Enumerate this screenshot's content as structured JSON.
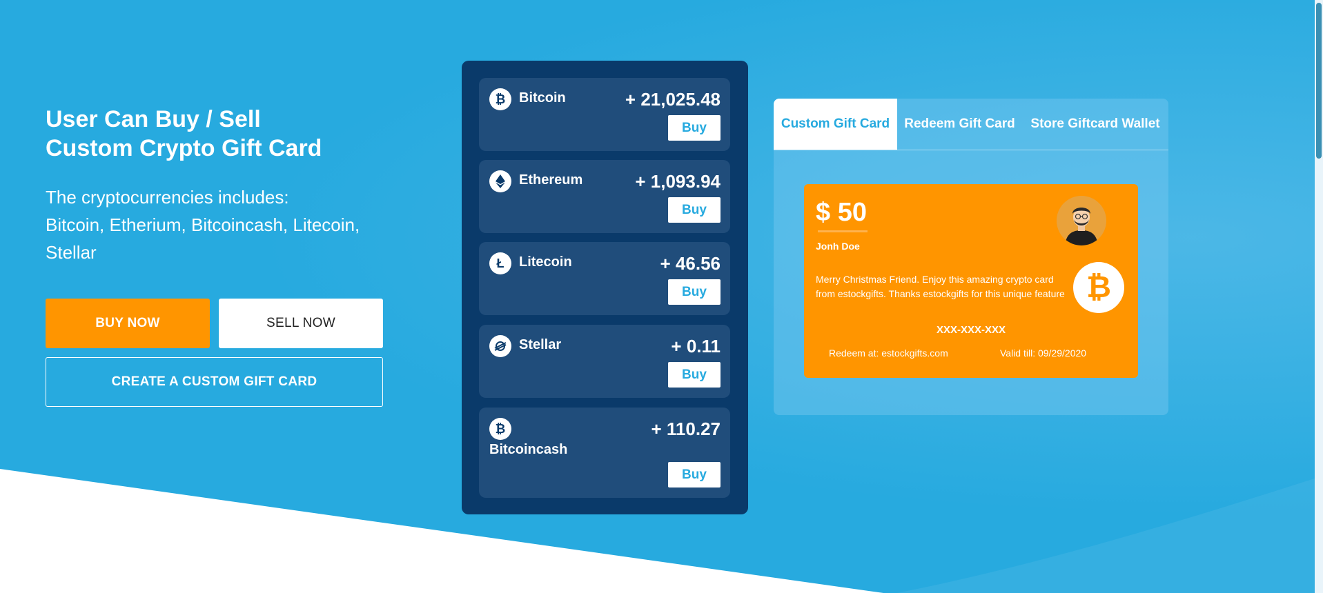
{
  "hero": {
    "title": "User Can Buy / Sell\nCustom Crypto Gift Card",
    "subtitle": "The cryptocurrencies includes:\nBitcoin, Etherium, Bitcoincash, Litecoin,\nStellar",
    "buy_now_label": "BUY NOW",
    "sell_now_label": "SELL NOW",
    "custom_card_label": "CREATE A CUSTOM GIFT CARD"
  },
  "coins": [
    {
      "name": "Bitcoin",
      "value": "+ 21,025.48",
      "buy_label": "Buy",
      "icon": "bitcoin-icon"
    },
    {
      "name": "Ethereum",
      "value": "+ 1,093.94",
      "buy_label": "Buy",
      "icon": "ethereum-icon"
    },
    {
      "name": "Litecoin",
      "value": "+ 46.56",
      "buy_label": "Buy",
      "icon": "litecoin-icon"
    },
    {
      "name": "Stellar",
      "value": "+ 0.11",
      "buy_label": "Buy",
      "icon": "stellar-icon"
    },
    {
      "name": "Bitcoincash",
      "value": "+ 110.27",
      "buy_label": "Buy",
      "icon": "bitcoincash-icon"
    }
  ],
  "tabs": [
    {
      "label": "Custom Gift Card",
      "active": true
    },
    {
      "label": "Redeem Gift Card",
      "active": false
    },
    {
      "label": "Store Giftcard Wallet",
      "active": false
    }
  ],
  "giftcard": {
    "amount": "$ 50",
    "holder": "Jonh Doe",
    "message": "Merry Christmas Friend. Enjoy this amazing crypto card from estockgifts. Thanks estockgifts for this unique feature",
    "code": "XXX-XXX-XXX",
    "redeem": "Redeem at: estockgifts.com",
    "valid": "Valid till: 09/29/2020",
    "btc_symbol": "₿"
  },
  "colors": {
    "background": "#27aadf",
    "accent_orange": "#ff9500",
    "panel_navy": "#0a3a6a",
    "coin_card": "#204d7b"
  }
}
